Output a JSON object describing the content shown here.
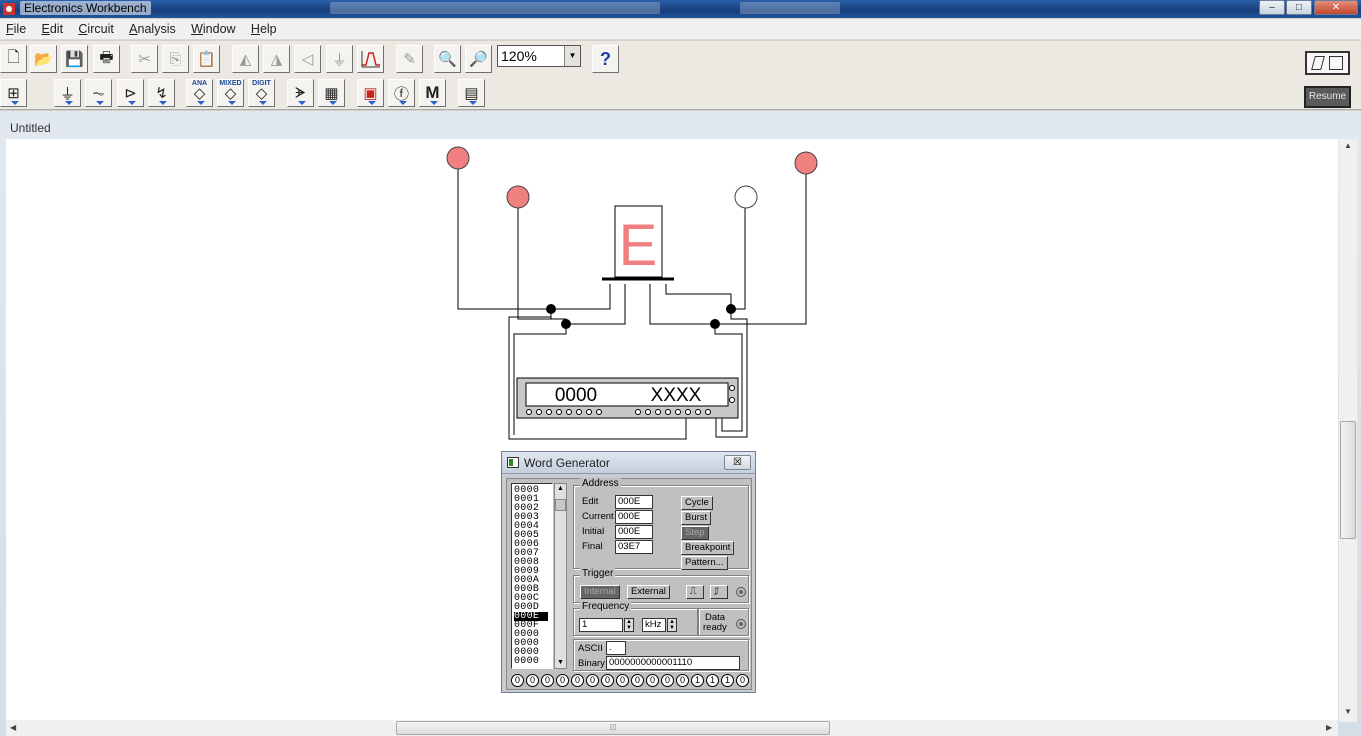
{
  "window": {
    "title": "Electronics Workbench",
    "controls": {
      "minimize": "–",
      "maximize": "□",
      "close": "✕"
    }
  },
  "menu": {
    "items": [
      {
        "key": "F",
        "rest": "ile"
      },
      {
        "key": "E",
        "rest": "dit"
      },
      {
        "key": "C",
        "rest": "ircuit"
      },
      {
        "key": "A",
        "rest": "nalysis"
      },
      {
        "key": "W",
        "rest": "indow"
      },
      {
        "key": "H",
        "rest": "elp"
      }
    ]
  },
  "toolbar": {
    "zoom_value": "120%",
    "help_label": "?",
    "analog_label": "ANA",
    "mixed_label": "MIXED",
    "digital_label": "DIGIT",
    "misc_label": "M"
  },
  "right_controls": {
    "resume_label": "Resume"
  },
  "document": {
    "title": "Untitled"
  },
  "circuit": {
    "display_letter": "E",
    "generator_strip_address": "0000",
    "generator_strip_data": "XXXX",
    "probe_colors": {
      "on": "#f08080",
      "off": "#ffffff"
    }
  },
  "word_generator": {
    "title": "Word Generator",
    "close_label": "☒",
    "list": [
      "0000",
      "0001",
      "0002",
      "0003",
      "0004",
      "0005",
      "0006",
      "0007",
      "0008",
      "0009",
      "000A",
      "000B",
      "000C",
      "000D",
      "000E",
      "000F",
      "0000",
      "0000",
      "0000",
      "0000"
    ],
    "selected_entry": "000E",
    "address": {
      "label": "Address",
      "edit_label": "Edit",
      "edit_value": "000E",
      "current_label": "Current",
      "current_value": "000E",
      "initial_label": "Initial",
      "initial_value": "000E",
      "final_label": "Final",
      "final_value": "03E7"
    },
    "buttons": {
      "cycle": "Cycle",
      "burst": "Burst",
      "step": "Step",
      "breakpoint": "Breakpoint",
      "pattern": "Pattern..."
    },
    "trigger": {
      "label": "Trigger",
      "internal": "Internal",
      "external": "External"
    },
    "frequency": {
      "label": "Frequency",
      "value": "1",
      "unit": "kHz"
    },
    "data_ready": {
      "line1": "Data",
      "line2": "ready"
    },
    "ascii": {
      "label": "ASCII",
      "value": "."
    },
    "binary": {
      "label": "Binary",
      "value": "0000000000001110"
    },
    "bits": [
      "0",
      "0",
      "0",
      "0",
      "0",
      "0",
      "0",
      "0",
      "0",
      "0",
      "0",
      "0",
      "1",
      "1",
      "1",
      "0"
    ]
  }
}
